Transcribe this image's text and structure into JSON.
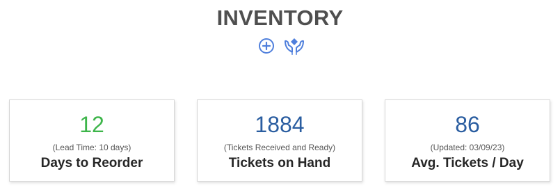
{
  "page": {
    "title": "INVENTORY"
  },
  "actions": {
    "add_icon": "plus-circle-icon",
    "care_icon": "hands-holding-icon",
    "accent_color": "#4f7fdc"
  },
  "cards": [
    {
      "value": "12",
      "sub": "(Lead Time: 10 days)",
      "label": "Days to Reorder",
      "value_color": "#3db54a"
    },
    {
      "value": "1884",
      "sub": "(Tickets Received and Ready)",
      "label": "Tickets on Hand",
      "value_color": "#2a5da0"
    },
    {
      "value": "86",
      "sub": "(Updated: 03/09/23)",
      "label": "Avg. Tickets / Day",
      "value_color": "#2a5da0"
    }
  ]
}
